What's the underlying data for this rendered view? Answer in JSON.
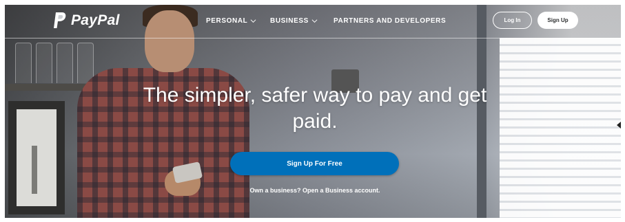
{
  "header": {
    "brand": "PayPal",
    "nav": [
      {
        "label": "PERSONAL",
        "has_dropdown": true
      },
      {
        "label": "BUSINESS",
        "has_dropdown": true
      },
      {
        "label": "PARTNERS AND DEVELOPERS",
        "has_dropdown": false
      }
    ],
    "login_label": "Log In",
    "signup_label": "Sign Up"
  },
  "hero": {
    "headline": "The simpler, safer way to pay and get paid.",
    "cta_label": "Sign Up For Free",
    "business_prompt": "Own a business? Open a Business account."
  },
  "colors": {
    "accent": "#0070ba",
    "text_on_hero": "#ffffff"
  },
  "icons": [
    "paypal-logo-icon",
    "chevron-down-icon"
  ]
}
